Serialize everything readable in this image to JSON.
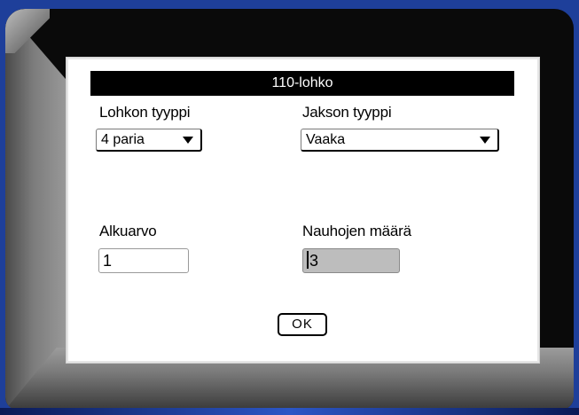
{
  "dialog": {
    "title": "110-lohko",
    "block_type": {
      "label": "Lohkon tyyppi",
      "value": "4 paria"
    },
    "sequence_type": {
      "label": "Jakson tyyppi",
      "value": "Vaaka"
    },
    "start_value": {
      "label": "Alkuarvo",
      "value": "1"
    },
    "strip_count": {
      "label": "Nauhojen määrä",
      "value": "3"
    },
    "ok_label": "OK"
  },
  "icons": [
    "chevron-down-icon"
  ],
  "colors": {
    "bezel_blue": "#1e3f9a",
    "title_bar": "#000000",
    "focused_field": "#bdbdbd"
  }
}
